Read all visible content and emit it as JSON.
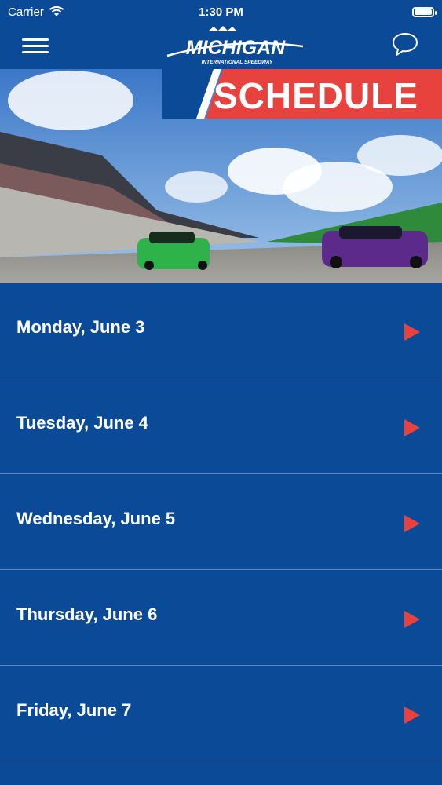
{
  "status_bar": {
    "carrier": "Carrier",
    "time": "1:30 PM",
    "battery_level": 1.0
  },
  "header": {
    "logo_text": "MICHIGAN",
    "logo_subtext": "INTERNATIONAL SPEEDWAY",
    "menu_icon": "hamburger-menu-icon",
    "chat_icon": "chat-bubble-icon"
  },
  "banner": {
    "title": "SCHEDULE"
  },
  "schedule": {
    "days": [
      {
        "label": "Monday, June 3"
      },
      {
        "label": "Tuesday, June 4"
      },
      {
        "label": "Wednesday, June 5"
      },
      {
        "label": "Thursday, June 6"
      },
      {
        "label": "Friday, June 7"
      }
    ],
    "arrow_icon": "play-arrow-icon"
  },
  "colors": {
    "background": "#0b4a96",
    "accent_red": "#e8423e",
    "divider": "#5d87bd"
  }
}
